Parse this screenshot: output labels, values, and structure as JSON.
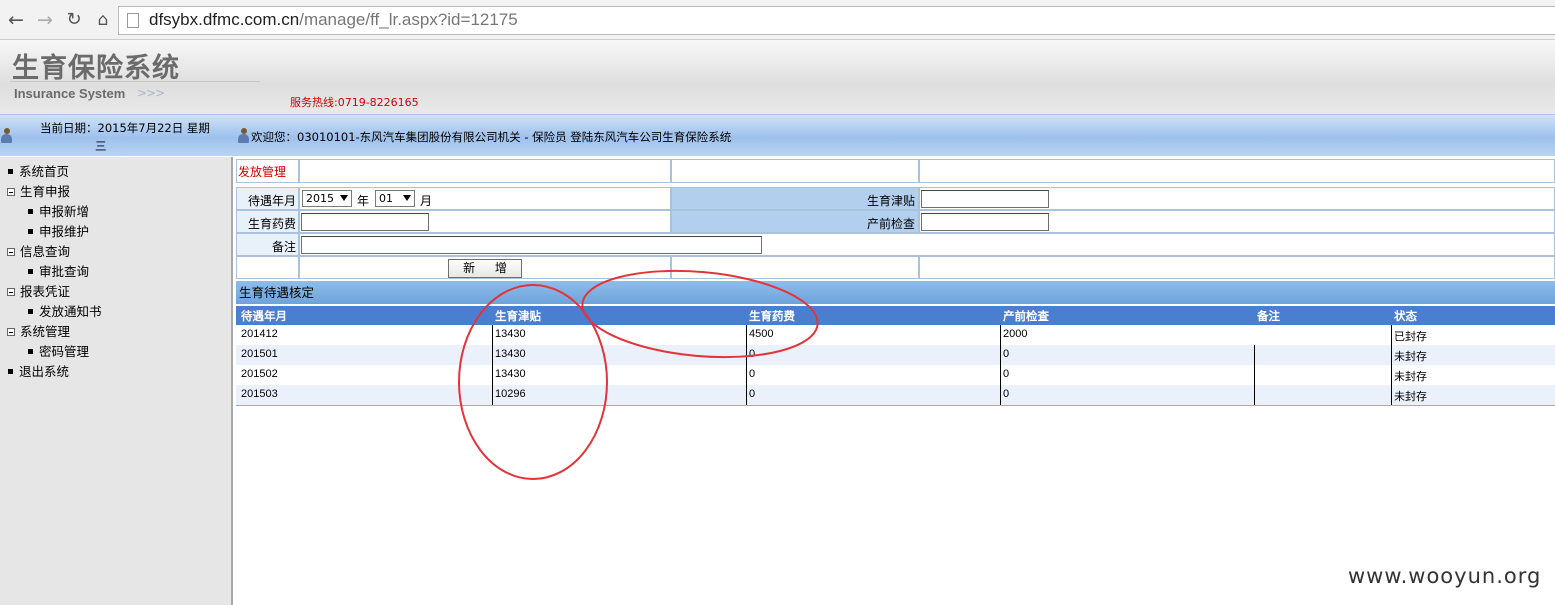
{
  "browser": {
    "url_host": "dfsybx.dfmc.com.cn",
    "url_path": "/manage/ff_lr.aspx?id=12175"
  },
  "header": {
    "title": "生育保险系统",
    "subtitle": "Insurance System",
    "arrows": ">>>",
    "hotline": "服务热线:0719-8226165"
  },
  "infobar": {
    "date": "当前日期：2015年7月22日  星期",
    "weekday": "三",
    "welcome": "欢迎您：03010101-东风汽车集团股份有限公司机关    -    保险员 登陆东风汽车公司生育保险系统"
  },
  "sidebar": {
    "items": [
      {
        "label": "系统首页",
        "kind": "top"
      },
      {
        "label": "生育申报",
        "kind": "group"
      },
      {
        "label": "申报新增",
        "kind": "child"
      },
      {
        "label": "申报维护",
        "kind": "child"
      },
      {
        "label": "信息查询",
        "kind": "group"
      },
      {
        "label": "审批查询",
        "kind": "child"
      },
      {
        "label": "报表凭证",
        "kind": "group"
      },
      {
        "label": "发放通知书",
        "kind": "child"
      },
      {
        "label": "系统管理",
        "kind": "group"
      },
      {
        "label": "密码管理",
        "kind": "child"
      },
      {
        "label": "退出系统",
        "kind": "top"
      }
    ]
  },
  "form": {
    "section_title": "发放管理",
    "year_month_label": "待遇年月",
    "year_value": "2015",
    "year_unit": "年",
    "month_value": "01",
    "month_unit": "月",
    "allowance_label": "生育津贴",
    "medical_label": "生育药费",
    "prenatal_label": "产前检查",
    "remark_label": "备注",
    "add_button": "新 增"
  },
  "table": {
    "section_title": "生育待遇核定",
    "columns": [
      "待遇年月",
      "生育津贴",
      "生育药费",
      "产前检查",
      "备注",
      "状态"
    ],
    "rows": [
      [
        "201412",
        "13430",
        "4500",
        "2000",
        "",
        "已封存"
      ],
      [
        "201501",
        "13430",
        "0",
        "0",
        "",
        "未封存"
      ],
      [
        "201502",
        "13430",
        "0",
        "0",
        "",
        "未封存"
      ],
      [
        "201503",
        "10296",
        "0",
        "0",
        "",
        "未封存"
      ]
    ]
  },
  "watermark": "www.wooyun.org",
  "colors": {
    "hotline": "#d40000",
    "section_title": "#cc0000",
    "table_header": "#4a7fd0",
    "annotation": "#e3343a"
  }
}
